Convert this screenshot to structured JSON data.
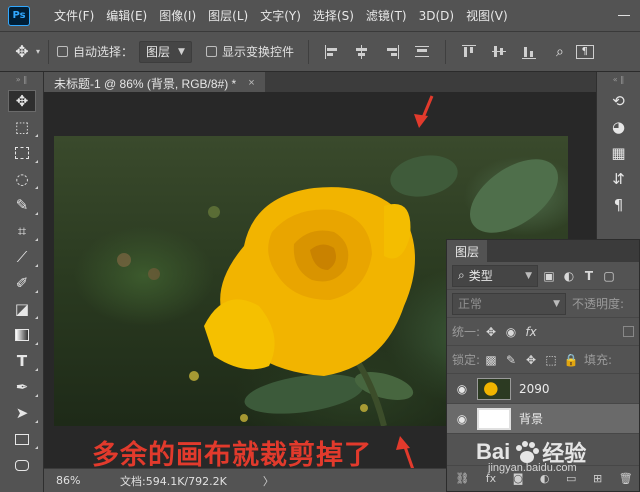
{
  "app": {
    "logo_text": "Ps"
  },
  "menu": [
    "文件(F)",
    "编辑(E)",
    "图像(I)",
    "图层(L)",
    "文字(Y)",
    "选择(S)",
    "滤镜(T)",
    "3D(D)",
    "视图(V)"
  ],
  "options_bar": {
    "auto_select_label": "自动选择：",
    "auto_select_value": "图层",
    "show_transform_label": "显示变换控件"
  },
  "document": {
    "tab_title": "未标题-1 @ 86% (背景, RGB/8#) *",
    "close_glyph": "×"
  },
  "status": {
    "zoom": "86%",
    "doc_info": "文档:594.1K/792.2K",
    "chevron": "〉"
  },
  "annotation_text": "多余的画布就裁剪掉了",
  "layers_panel": {
    "title": "图层",
    "filter_label": "类型",
    "blend_mode": "正常",
    "opacity_label": "不透明度:",
    "unify_label": "统一:",
    "lock_label": "锁定:",
    "fill_label": "填充:",
    "layers": [
      {
        "name": "2090",
        "visible": true,
        "selected": false
      },
      {
        "name": "背景",
        "visible": true,
        "selected": true
      }
    ],
    "footer_icons": [
      "link-icon",
      "fx-icon",
      "mask-icon",
      "adjustment-icon",
      "folder-icon",
      "new-layer-icon",
      "trash-icon"
    ]
  },
  "watermark": {
    "text_left": "Bai",
    "text_right": "经验",
    "subtext": "jingyan.baidu.com"
  },
  "colors": {
    "annotation": "#e23a2c",
    "rose": "#f2b400",
    "panel": "#535353",
    "canvas_bg": "#282828"
  }
}
